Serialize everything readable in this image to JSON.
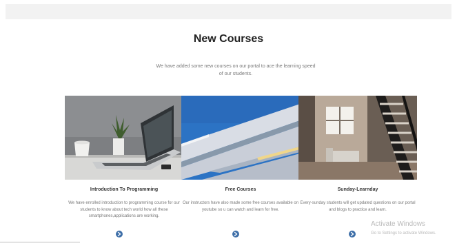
{
  "section": {
    "title": "New Courses",
    "subtitle": "We have added some new courses on our portal to ace the learning speed of our students."
  },
  "cards": [
    {
      "title": "Introduction To Programming",
      "description": "We have enrolled introduction to programming course for our students to know about tech world how all these smartphones,applications are working.",
      "link_icon": "arrow-right-circle-icon"
    },
    {
      "title": "Free Courses",
      "description": "Our instructors have also made some free courses available on youtube so u can watch and learn for free.",
      "link_icon": "arrow-right-circle-icon"
    },
    {
      "title": "Sunday-Learnday",
      "description": "Every-sunday students will get updated questions on our portal and blogs to practice and learn.",
      "link_icon": "arrow-right-circle-icon"
    }
  ],
  "watermark": {
    "line1": "Activate Windows",
    "line2": "Go to Settings to activate Windows."
  },
  "colors": {
    "accent": "#3e6fa8",
    "muted_text": "#777777",
    "heading": "#222222",
    "topbar": "#f2f2f2"
  }
}
